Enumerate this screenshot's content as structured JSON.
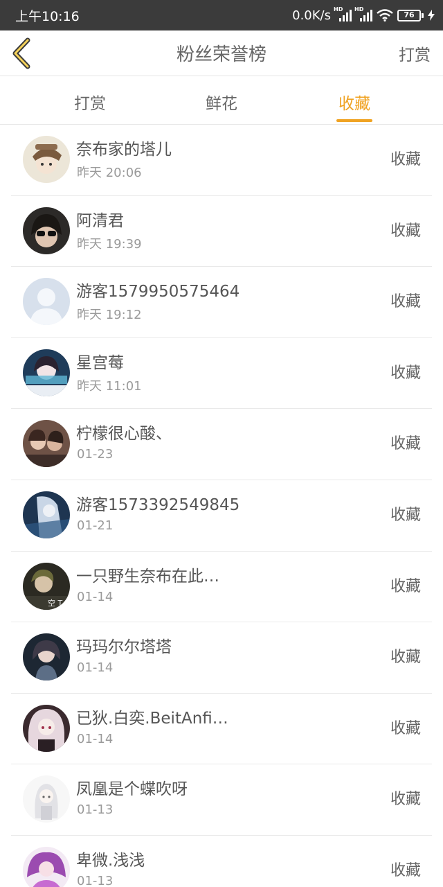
{
  "status_bar": {
    "time": "上午10:16",
    "network_speed": "0.0K/s",
    "signal_label_1": "HD",
    "signal_label_2": "HD",
    "battery_level": "76"
  },
  "header": {
    "back_icon": "chevron-left-icon",
    "title": "粉丝荣誉榜",
    "right_action": "打赏"
  },
  "tabs": [
    {
      "label": "打赏",
      "active": false
    },
    {
      "label": "鲜花",
      "active": false
    },
    {
      "label": "收藏",
      "active": true
    }
  ],
  "colors": {
    "accent": "#f0a323",
    "status_bar_bg": "#3b3b3b",
    "battery_green": "#4caf50"
  },
  "fans": [
    {
      "name": "奈布家的塔儿",
      "time": "昨天 20:06",
      "action": "收藏"
    },
    {
      "name": "阿清君",
      "time": "昨天 19:39",
      "action": "收藏"
    },
    {
      "name": "游客1579950575464",
      "time": "昨天 19:12",
      "action": "收藏"
    },
    {
      "name": "星宫莓",
      "time": "昨天 11:01",
      "action": "收藏"
    },
    {
      "name": "柠檬很心酸、",
      "time": "01-23",
      "action": "收藏"
    },
    {
      "name": "游客1573392549845",
      "time": "01-21",
      "action": "收藏"
    },
    {
      "name": "一只野生奈布在此…",
      "time": "01-14",
      "action": "收藏"
    },
    {
      "name": "玛玛尔尔塔塔",
      "time": "01-14",
      "action": "收藏"
    },
    {
      "name": "已狄.白奕.BeitAnfi…",
      "time": "01-14",
      "action": "收藏"
    },
    {
      "name": "凤凰是个蝶吹呀",
      "time": "01-13",
      "action": "收藏"
    },
    {
      "name": "卑微.浅浅",
      "time": "01-13",
      "action": "收藏"
    }
  ]
}
